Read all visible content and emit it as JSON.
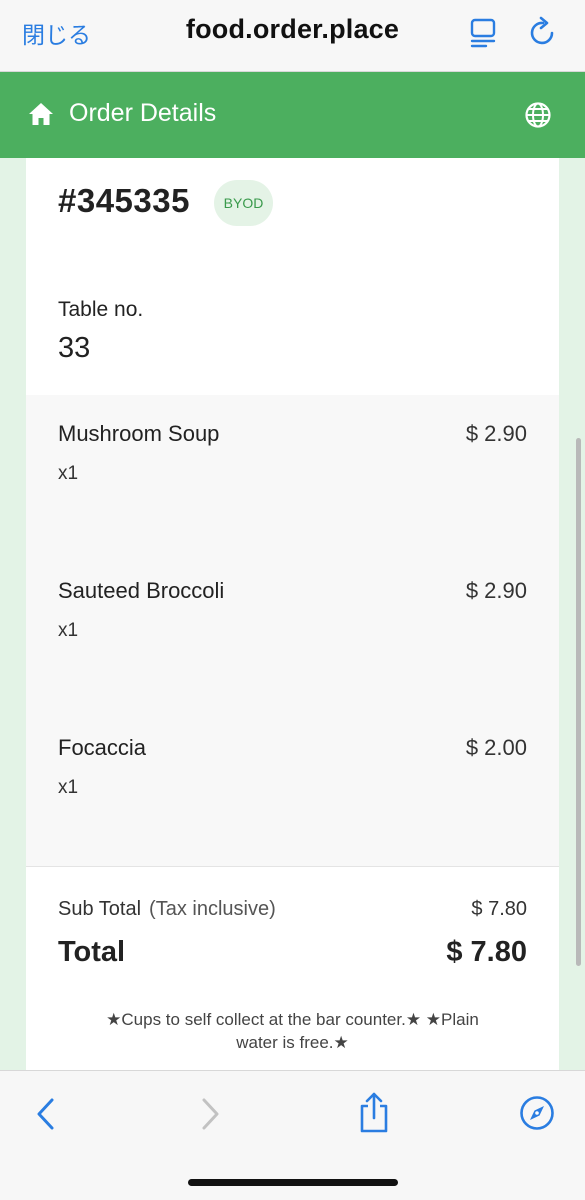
{
  "browser": {
    "close_label": "閉じる",
    "url": "food.order.place",
    "icons": [
      "reader-view-icon",
      "reload-icon"
    ]
  },
  "header": {
    "title": "Order Details",
    "icons": [
      "home-icon",
      "globe-icon"
    ],
    "color": "#4caf5f"
  },
  "order": {
    "number": "#345335",
    "badge": "BYOD",
    "table_label": "Table no.",
    "table_value": "33"
  },
  "items": [
    {
      "name": "Mushroom Soup",
      "qty": "x1",
      "price": "$ 2.90"
    },
    {
      "name": "Sauteed Broccoli",
      "qty": "x1",
      "price": "$ 2.90"
    },
    {
      "name": "Focaccia",
      "qty": "x1",
      "price": "$ 2.00"
    }
  ],
  "summary": {
    "subtotal_label": "Sub Total",
    "subtotal_note": "(Tax inclusive)",
    "subtotal_value": "$ 7.80",
    "total_label": "Total",
    "total_value": "$ 7.80",
    "notice": "★Cups to self collect at the bar counter.★ ★Plain water is free.★"
  },
  "bottom_bar": {
    "icons": [
      "back-icon",
      "forward-icon",
      "share-icon",
      "compass-icon"
    ]
  }
}
